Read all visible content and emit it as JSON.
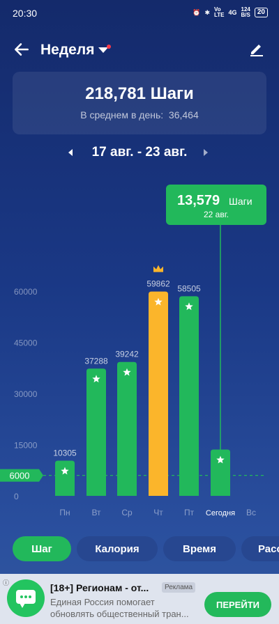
{
  "status": {
    "time": "20:30",
    "net1": "Vo",
    "net2": "LTE",
    "net3": "4G",
    "speed": "124",
    "speed_unit": "B/S",
    "battery": "20"
  },
  "header": {
    "title": "Неделя"
  },
  "summary": {
    "total": "218,781 Шаги",
    "avg_label": "В среднем в день:",
    "avg_value": "36,464"
  },
  "range": {
    "label": "17 авг. - 23 авг."
  },
  "chart_data": {
    "type": "bar",
    "categories": [
      "Пн",
      "Вт",
      "Ср",
      "Чт",
      "Пт",
      "Сегодня",
      "Вс"
    ],
    "values": [
      10305,
      37288,
      39242,
      59862,
      58505,
      13579,
      null
    ],
    "value_labels": [
      "10305",
      "37288",
      "39242",
      "59862",
      "58505",
      "",
      ""
    ],
    "highlight_index": 3,
    "selected_index": 5,
    "yticks": [
      "60000",
      "45000",
      "30000",
      "15000",
      "0"
    ],
    "ytick_values": [
      60000,
      45000,
      30000,
      15000,
      0
    ],
    "goal": 6000,
    "goal_label": "6000",
    "ylim": [
      0,
      60000
    ],
    "colors": {
      "normal": "#22b85b",
      "best": "#fbb52b",
      "goal_line": "#22b85b"
    }
  },
  "tooltip": {
    "value": "13,579",
    "unit": "Шаги",
    "date": "22 авг."
  },
  "tabs": [
    {
      "label": "Шаг",
      "active": true
    },
    {
      "label": "Калория",
      "active": false
    },
    {
      "label": "Время",
      "active": false
    },
    {
      "label": "Расс",
      "active": false
    }
  ],
  "ad": {
    "title": "[18+] Регионам - от...",
    "badge": "Реклама",
    "text": "Единая Россия помогает обновлять общественный тран...",
    "cta": "ПЕРЕЙТИ"
  }
}
